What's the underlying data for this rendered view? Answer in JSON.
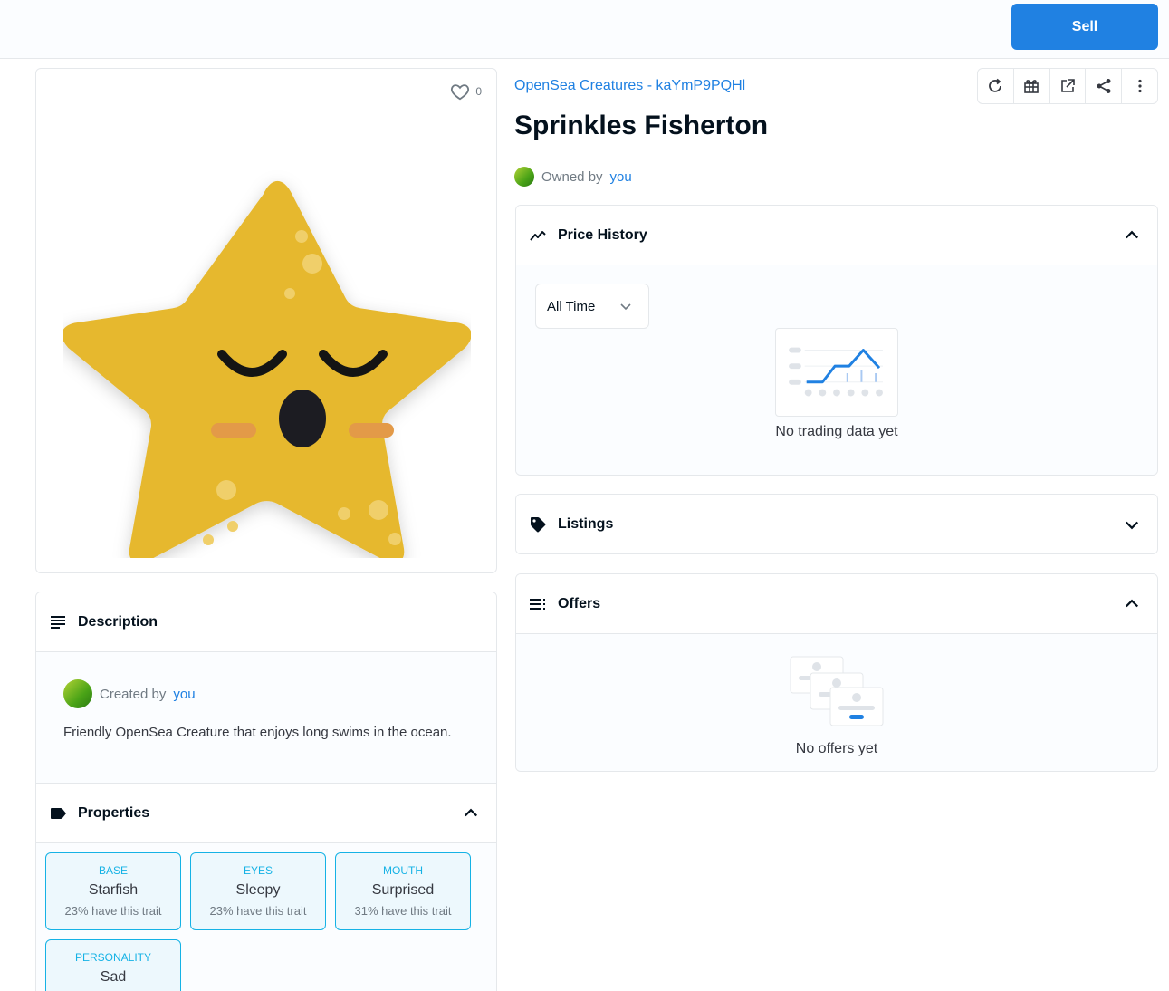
{
  "topbar": {
    "sell_label": "Sell"
  },
  "asset": {
    "collection": "OpenSea Creatures - kaYmP9PQHl",
    "name": "Sprinkles Fisherton",
    "owned_prefix": "Owned by",
    "owner": "you",
    "favorites": "0"
  },
  "toolbar": [
    "refresh-icon",
    "gift-icon",
    "external-link-icon",
    "share-icon",
    "more-icon"
  ],
  "description": {
    "heading": "Description",
    "created_prefix": "Created by",
    "creator": "you",
    "text": "Friendly OpenSea Creature that enjoys long swims in the ocean."
  },
  "properties": {
    "heading": "Properties",
    "items": [
      {
        "type": "BASE",
        "value": "Starfish",
        "rarity": "23% have this trait"
      },
      {
        "type": "EYES",
        "value": "Sleepy",
        "rarity": "23% have this trait"
      },
      {
        "type": "MOUTH",
        "value": "Surprised",
        "rarity": "31% have this trait"
      },
      {
        "type": "PERSONALITY",
        "value": "Sad",
        "rarity": ""
      }
    ]
  },
  "price_history": {
    "heading": "Price History",
    "range": "All Time",
    "empty": "No trading data yet"
  },
  "listings": {
    "heading": "Listings"
  },
  "offers": {
    "heading": "Offers",
    "empty": "No offers yet"
  },
  "colors": {
    "accent": "#2081e2",
    "trait": "#15b2e5",
    "star": "#e6b82e"
  }
}
